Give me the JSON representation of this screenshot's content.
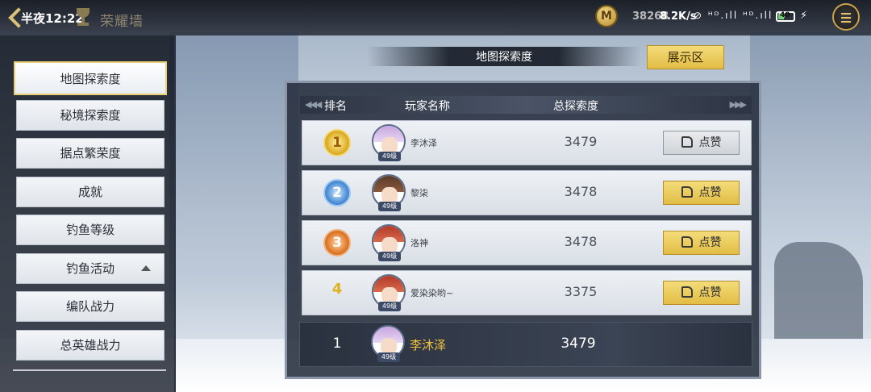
{
  "status_bar": {
    "time": "半夜12:22",
    "net_speed": "8.2K/s",
    "sys_icons": "⊘ ᴴᴰ.ıll ᴴᴰ.ıll ≋",
    "battery": "40",
    "charge": "⚡"
  },
  "header": {
    "title": "荣耀墙",
    "coin_symbol": "M",
    "coin_amount": "38268"
  },
  "sidebar": {
    "items": [
      {
        "label": "地图探索度",
        "active": true
      },
      {
        "label": "秘境探索度"
      },
      {
        "label": "据点繁荣度"
      },
      {
        "label": "成就"
      },
      {
        "label": "钓鱼等级"
      },
      {
        "label": "钓鱼活动",
        "expanded": true
      },
      {
        "label": "编队战力"
      },
      {
        "label": "总英雄战力"
      }
    ]
  },
  "board": {
    "title": "地图探索度",
    "show_button": "展示区",
    "columns": {
      "rank": "排名",
      "player": "玩家名称",
      "score": "总探索度"
    },
    "rows": [
      {
        "rank": "1",
        "name": "李沐泽",
        "level": "49级",
        "score": "3479",
        "like_label": "点赞",
        "like_state": "liked"
      },
      {
        "rank": "2",
        "name": "黎柒",
        "level": "49级",
        "score": "3478",
        "like_label": "点赞",
        "like_state": "available"
      },
      {
        "rank": "3",
        "name": "洛神",
        "level": "49级",
        "score": "3478",
        "like_label": "点赞",
        "like_state": "available"
      },
      {
        "rank": "4",
        "name": "爱染染哟~",
        "level": "49级",
        "score": "3375",
        "like_label": "点赞",
        "like_state": "available"
      }
    ],
    "self": {
      "rank": "1",
      "name": "李沐泽",
      "level": "49级",
      "score": "3479"
    }
  },
  "colors": {
    "accent_gold": "#e2bd45",
    "highlight_name": "#f0c23c",
    "panel_dark": "#262e3c"
  }
}
